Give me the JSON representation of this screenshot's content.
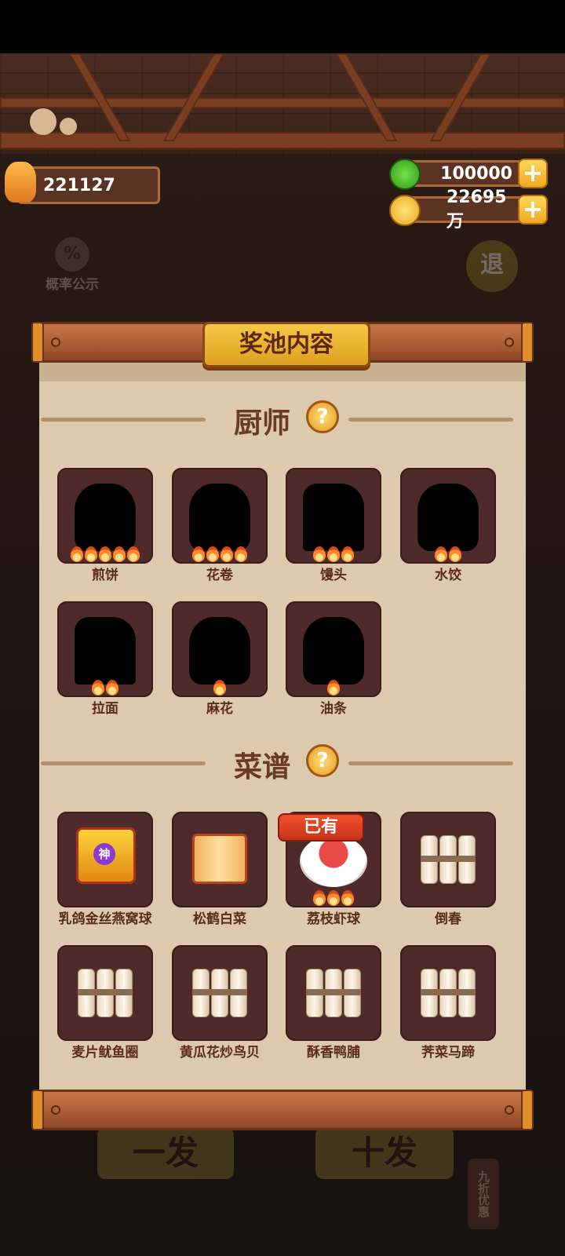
{
  "header": {
    "player_value": "221127",
    "currency_green": "100000",
    "currency_gold": "22695万",
    "plus_symbol": "+"
  },
  "background": {
    "probability_label": "概率公示",
    "percent_symbol": "%",
    "exit_label": "退",
    "single_draw_label": "一发",
    "ten_draw_label": "十发",
    "discount_label": "九折优惠"
  },
  "panel": {
    "title": "奖池内容",
    "help_symbol": "?"
  },
  "chefs": {
    "title": "厨师",
    "items": [
      {
        "name": "煎饼",
        "stars": 5
      },
      {
        "name": "花卷",
        "stars": 4
      },
      {
        "name": "馒头",
        "stars": 3
      },
      {
        "name": "水饺",
        "stars": 2
      },
      {
        "name": "拉面",
        "stars": 2
      },
      {
        "name": "麻花",
        "stars": 1
      },
      {
        "name": "油条",
        "stars": 1
      }
    ]
  },
  "recipes": {
    "title": "菜谱",
    "owned_badge": "已有",
    "divine_badge": "神",
    "items": [
      {
        "name": "乳鸽金丝燕窝球"
      },
      {
        "name": "松鹤白菜"
      },
      {
        "name": "荔枝虾球",
        "owned": true,
        "stars": 3
      },
      {
        "name": "倒春"
      },
      {
        "name": "麦片鱿鱼圈"
      },
      {
        "name": "黄瓜花炒鸟贝"
      },
      {
        "name": "酥香鸭脯"
      },
      {
        "name": "荠菜马蹄"
      }
    ]
  },
  "colors": {
    "accent_gold": "#f5c744",
    "board_brown": "#a85a32",
    "paper": "#ddc9ad",
    "card": "#4e2a2a",
    "badge_red": "#e0402a"
  }
}
